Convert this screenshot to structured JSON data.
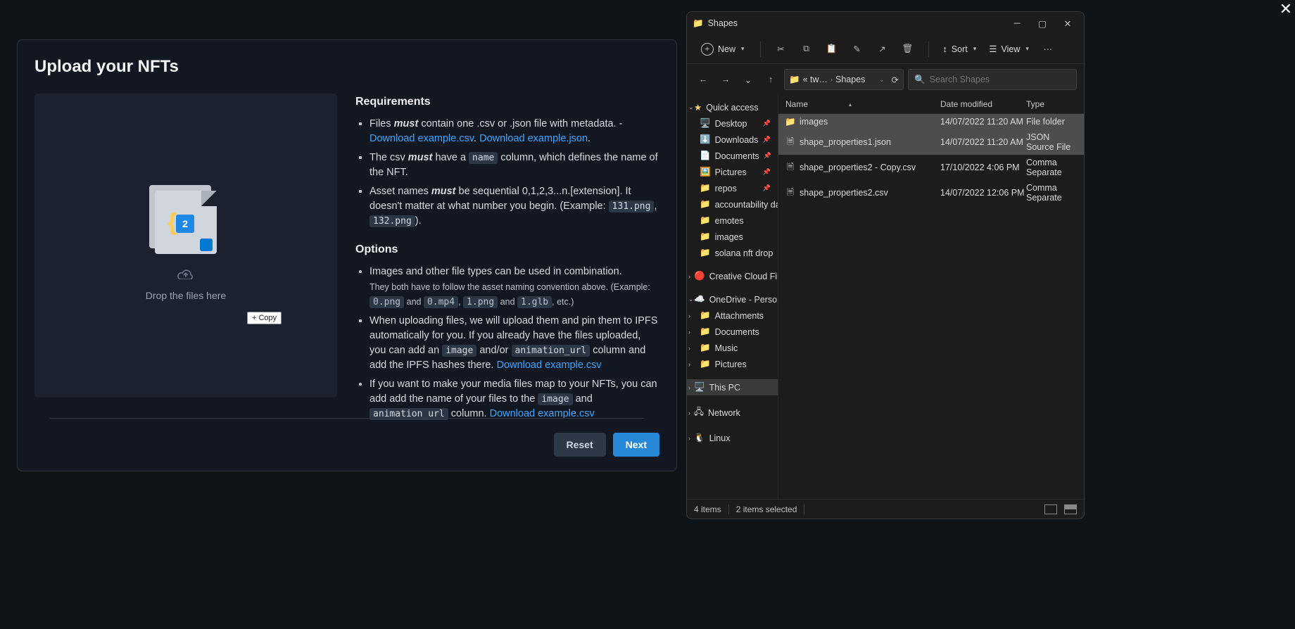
{
  "page": {
    "title": "Upload your NFTs",
    "drop_text": "Drop the files here",
    "drag_hint": "+ Copy",
    "drag_badge_count": "2",
    "requirements_heading": "Requirements",
    "options_heading": "Options",
    "req1_a": "Files ",
    "req1_em": "must",
    "req1_b": " contain one .csv or .json file with metadata. - ",
    "link_csv": "Download example.csv",
    "link_json": "Download example.json",
    "req2_a": "The csv ",
    "req2_em": "must",
    "req2_b": " have a ",
    "req2_code": "name",
    "req2_c": " column, which defines the name of the NFT.",
    "req3_a": "Asset names ",
    "req3_em": "must",
    "req3_b": " be sequential 0,1,2,3...n.[extension]. It doesn't matter at what number you begin. (Example: ",
    "req3_code1": "131.png",
    "req3_code2": "132.png",
    "req3_tail": ").",
    "opt1": "Images and other file types can be used in combination.",
    "opt1_note_a": "They both have to follow the asset naming convention above. (Example: ",
    "opt1_c1": "0.png",
    "opt1_and": " and ",
    "opt1_c2": "0.mp4",
    "opt1_c3": "1.png",
    "opt1_c4": "1.glb",
    "opt1_etc": ", etc.)",
    "opt2_a": "When uploading files, we will upload them and pin them to IPFS automatically for you. If you already have the files uploaded, you can add an ",
    "opt2_c1": "image",
    "opt2_b": " and/or ",
    "opt2_c2": "animation_url",
    "opt2_c": " column and add the IPFS hashes there. ",
    "opt2_link": "Download example.csv",
    "opt3_a": "If you want to make your media files map to your NFTs, you can add add the name of your files to the ",
    "opt3_c1": "image",
    "opt3_b": " and ",
    "opt3_c2": "animation_url",
    "opt3_c": " column. ",
    "opt3_link": "Download example.csv",
    "reset_label": "Reset",
    "next_label": "Next"
  },
  "explorer": {
    "title": "Shapes",
    "toolbar": {
      "new": "New",
      "sort": "Sort",
      "view": "View"
    },
    "breadcrumb": {
      "prefix": "« tw…",
      "current": "Shapes"
    },
    "search_placeholder": "Search Shapes",
    "nav": {
      "quick_access": "Quick access",
      "pinned": [
        "Desktop",
        "Downloads",
        "Documents",
        "Pictures",
        "repos"
      ],
      "recent": [
        "accountability dao",
        "emotes",
        "images",
        "solana nft drop"
      ],
      "creative": "Creative Cloud Files",
      "onedrive": "OneDrive - Personal",
      "onedrive_children": [
        "Attachments",
        "Documents",
        "Music",
        "Pictures"
      ],
      "this_pc": "This PC",
      "network": "Network",
      "linux": "Linux"
    },
    "columns": {
      "name": "Name",
      "date": "Date modified",
      "type": "Type"
    },
    "rows": [
      {
        "name": "images",
        "date": "14/07/2022 11:20 AM",
        "type": "File folder",
        "kind": "folder"
      },
      {
        "name": "shape_properties1.json",
        "date": "14/07/2022 11:20 AM",
        "type": "JSON Source File",
        "kind": "file"
      },
      {
        "name": "shape_properties2 - Copy.csv",
        "date": "17/10/2022 4:06 PM",
        "type": "Comma Separate",
        "kind": "file"
      },
      {
        "name": "shape_properties2.csv",
        "date": "14/07/2022 12:06 PM",
        "type": "Comma Separate",
        "kind": "file"
      }
    ],
    "status": {
      "items": "4 items",
      "selected": "2 items selected"
    }
  }
}
